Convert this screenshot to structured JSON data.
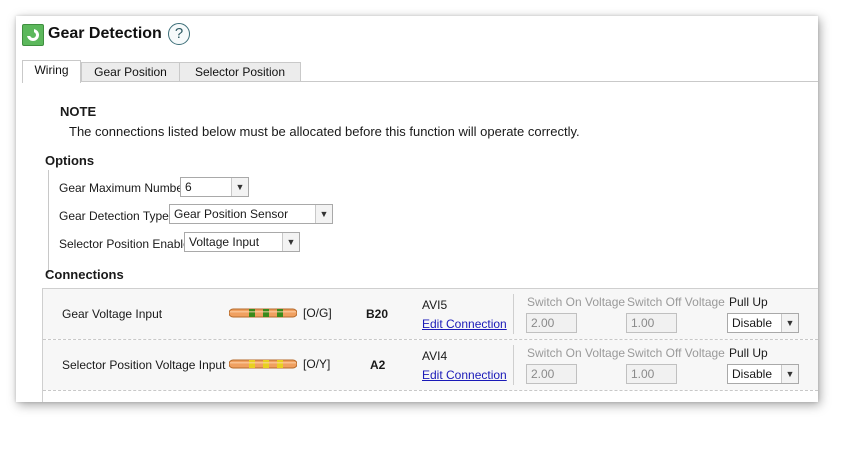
{
  "window": {
    "title": "Gear Detection",
    "help_icon": "?"
  },
  "tabs": [
    {
      "label": "Wiring",
      "active": true
    },
    {
      "label": "Gear Position",
      "active": false
    },
    {
      "label": "Selector Position",
      "active": false
    }
  ],
  "note": {
    "heading": "NOTE",
    "text": "The connections listed below must be allocated before this function will operate correctly."
  },
  "options": {
    "heading": "Options",
    "gear_max": {
      "label": "Gear Maximum Number",
      "value": "6"
    },
    "gear_detection_type": {
      "label": "Gear Detection Type",
      "value": "Gear Position Sensor"
    },
    "selector_enable": {
      "label": "Selector Position Enable",
      "value": "Voltage Input"
    }
  },
  "connections": {
    "heading": "Connections",
    "rows": [
      {
        "name": "Gear Voltage Input",
        "wire_code": "[O/G]",
        "wire_colors": {
          "base": "#f0a060",
          "stripe": "#3a8a1c"
        },
        "pin": "B20",
        "channel": "AVI5",
        "edit_label": "Edit Connection",
        "switch_on_label": "Switch On Voltage",
        "switch_on_value": "2.00",
        "switch_off_label": "Switch Off Voltage",
        "switch_off_value": "1.00",
        "pullup_label": "Pull Up",
        "pullup_value": "Disable"
      },
      {
        "name": "Selector Position Voltage Input",
        "wire_code": "[O/Y]",
        "wire_colors": {
          "base": "#f0a060",
          "stripe": "#e8d020"
        },
        "pin": "A2",
        "channel": "AVI4",
        "edit_label": "Edit Connection",
        "switch_on_label": "Switch On Voltage",
        "switch_on_value": "2.00",
        "switch_off_label": "Switch Off Voltage",
        "switch_off_value": "1.00",
        "pullup_label": "Pull Up",
        "pullup_value": "Disable"
      }
    ]
  },
  "colors": {
    "link": "#1a1ab8",
    "app_icon": "#5cb85c",
    "disabled_text": "#9a9a9a"
  }
}
